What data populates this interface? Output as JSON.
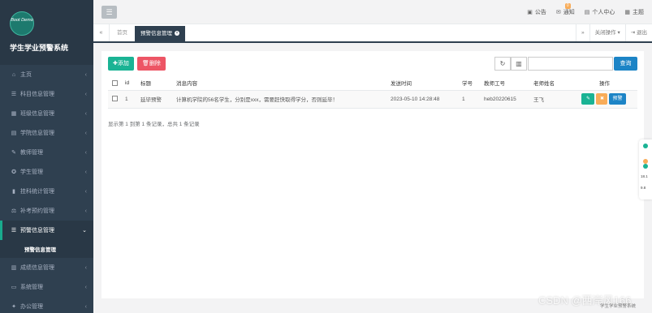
{
  "brand": {
    "logo_text": "Boot Demo",
    "system_title": "学生学业预警系统"
  },
  "sidebar": {
    "items": [
      {
        "icon": "home-icon",
        "glyph": "⌂",
        "label": "主页"
      },
      {
        "icon": "list-icon",
        "glyph": "☰",
        "label": "科目信息管理"
      },
      {
        "icon": "calendar-icon",
        "glyph": "▦",
        "label": "班级信息管理"
      },
      {
        "icon": "document-icon",
        "glyph": "▤",
        "label": "学院信息管理"
      },
      {
        "icon": "teacher-icon",
        "glyph": "✎",
        "label": "教师管理"
      },
      {
        "icon": "student-icon",
        "glyph": "✪",
        "label": "学生管理"
      },
      {
        "icon": "stats-icon",
        "glyph": "▮",
        "label": "挂科统计管理"
      },
      {
        "icon": "balance-icon",
        "glyph": "⚖",
        "label": "补考预约管理"
      },
      {
        "icon": "list-icon",
        "glyph": "☰",
        "label": "预警信息管理",
        "active": true
      },
      {
        "icon": "bar-chart-icon",
        "glyph": "▥",
        "label": "成绩信息管理"
      },
      {
        "icon": "monitor-icon",
        "glyph": "▭",
        "label": "系统管理"
      },
      {
        "icon": "tool-icon",
        "glyph": "✦",
        "label": "办公管理"
      }
    ],
    "submenu_label": "预警信息管理"
  },
  "topbar": {
    "notice": "公告",
    "notify": "通知",
    "notify_badge": "0",
    "profile": "个人中心",
    "theme": "主题"
  },
  "tabs": {
    "home": "首页",
    "active": "预警信息管理",
    "close_ops": "关闭操作",
    "logout": "退出"
  },
  "toolbar": {
    "add": "添加",
    "delete": "删除",
    "search": "查询",
    "search_placeholder": ""
  },
  "table": {
    "headers": [
      "id",
      "标题",
      "消息内容",
      "发送时间",
      "学号",
      "教师工号",
      "老师姓名",
      "操作"
    ],
    "rows": [
      {
        "id": "1",
        "title": "延毕预警",
        "content": "计算机学院的56名学生，分别是xxx，需要赶快取得学分，否则延毕！",
        "time": "2023-05-10 14:28:48",
        "student_no": "1",
        "teacher_no": "heb20220615",
        "teacher_name": "王飞",
        "warn_label": "预警"
      }
    ]
  },
  "pager": "显示第 1 到第 1 条记录，总共 1 条记录",
  "widget": {
    "v1": "18.1",
    "v2": "9.8"
  },
  "watermark": "CSDN @西岸风166",
  "footer_system": "学生学业预警系统"
}
